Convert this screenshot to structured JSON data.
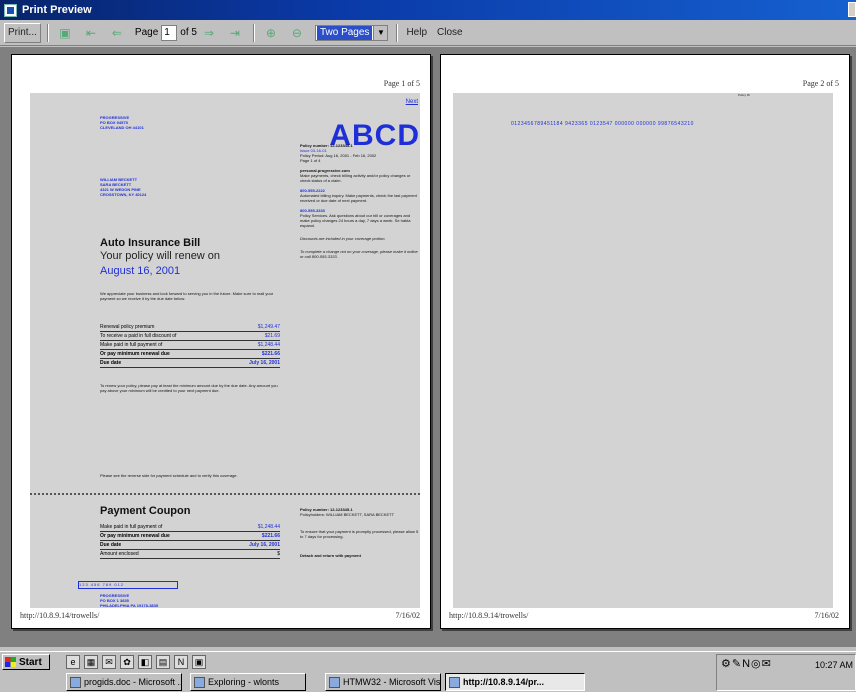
{
  "window": {
    "title": "Print Preview"
  },
  "toolbar": {
    "print_label": "Print...",
    "page_label": "Page",
    "page_value": "1",
    "of_label": "of 5",
    "zoom_value": "Two Pages",
    "help_label": "Help",
    "close_label": "Close"
  },
  "page1": {
    "page_number": "Page 1 of 5",
    "next_link": "Next",
    "logo": "ABCD",
    "sender": [
      "PROGRESSIVE",
      "PO BOX 94575",
      "CLEVELAND OH 44101"
    ],
    "recipient": [
      "WILLIAM BECKETT",
      "SARA BECKETT",
      "4321 W WEDON PINE",
      "CROSSTOWN, KY 40124"
    ],
    "title": "Auto Insurance Bill",
    "renew_line": "Your policy will renew on",
    "renew_date": "August 16, 2001",
    "intro": "We appreciate your business and look forward to serving you in the future. Make sure to mail your payment so we receive it by the due date below.",
    "table": [
      {
        "label": "Renewal policy premium",
        "value": "$1,249.47"
      },
      {
        "label": "To receive a paid in full discount of",
        "value": "$21.69"
      },
      {
        "label": "Make paid in full payment of",
        "value": "$1,248.44"
      },
      {
        "label": "Or pay minimum renewal due",
        "value": "$221.66"
      },
      {
        "label": "Due date",
        "value": "July 16, 2001"
      }
    ],
    "note": "To renew your policy, please pay at least the minimum amount due by the due date. Any amount you pay above your minimum will be credited to your next payment due.",
    "reverse_note": "Please see the reverse side for payment schedule and to verify this coverage.",
    "right": {
      "policy": "Policy number: 12-123345-1",
      "lines": [
        "Issue 03-16-01",
        "Policy Period: Aug 16, 2001 - Feb 16, 2002",
        "Page 1 of 4"
      ],
      "web_h": "personal.progressive.com",
      "web": "Make payments, check billing activity and/or policy changes or check status of a claim.",
      "p1_h": "800-555-2222",
      "p1": "Automated billing inquiry. Make payments, check the last payment received or due date of next payment.",
      "p2_h": "800-555-3333",
      "p2": "Policy Services. Ask questions about our bill or coverages and make policy changes 24 hours a day, 7 days a week. Se habla espanol.",
      "i1": "Discounts are included in your coverage portion.",
      "i2": "To complete a change not on your coverage, please make it online or call 800-555-3333."
    },
    "coupon": {
      "title": "Payment Coupon",
      "rows": [
        {
          "label": "Make paid in full payment of",
          "value": "$1,248.44"
        },
        {
          "label": "Or pay minimum renewal due",
          "value": "$221.66"
        },
        {
          "label": "Due date",
          "value": "July 16, 2001"
        },
        {
          "label": "Amount enclosed",
          "value": "$"
        }
      ],
      "policy": "Policy number: 12-123345-1",
      "holder": "Policyholders: WILLIAM BECKETT, SARA BECKETT",
      "remit": [
        "PROGRESSIVE",
        "PO BOX 1 3835",
        "PHILADELPHIA PA 19178-3835"
      ],
      "barcode": "123  456  789  012",
      "side_note": "To ensure that your payment is promptly processed, please allow 5 to 7 days for processing.",
      "detach": "Detach and return with payment"
    },
    "footer_url": "http://10.8.9.14/trowells/",
    "footer_date": "7/16/02"
  },
  "page2": {
    "page_number": "Page 2 of 5",
    "header": "Policy ID",
    "code": "0123456789451184  9423365 0123547  000000  000000  99876543210",
    "footer_url": "http://10.8.9.14/trowells/",
    "footer_date": "7/16/02"
  },
  "taskbar": {
    "start": "Start",
    "tasks": [
      {
        "label": "progids.doc - Microsoft ..."
      },
      {
        "label": "Exploring - wlonts"
      },
      {
        "label": "HTMW32 - Microsoft Vis..."
      },
      {
        "label": "http://10.8.9.14/pr..."
      }
    ],
    "clock": "10:27 AM"
  }
}
